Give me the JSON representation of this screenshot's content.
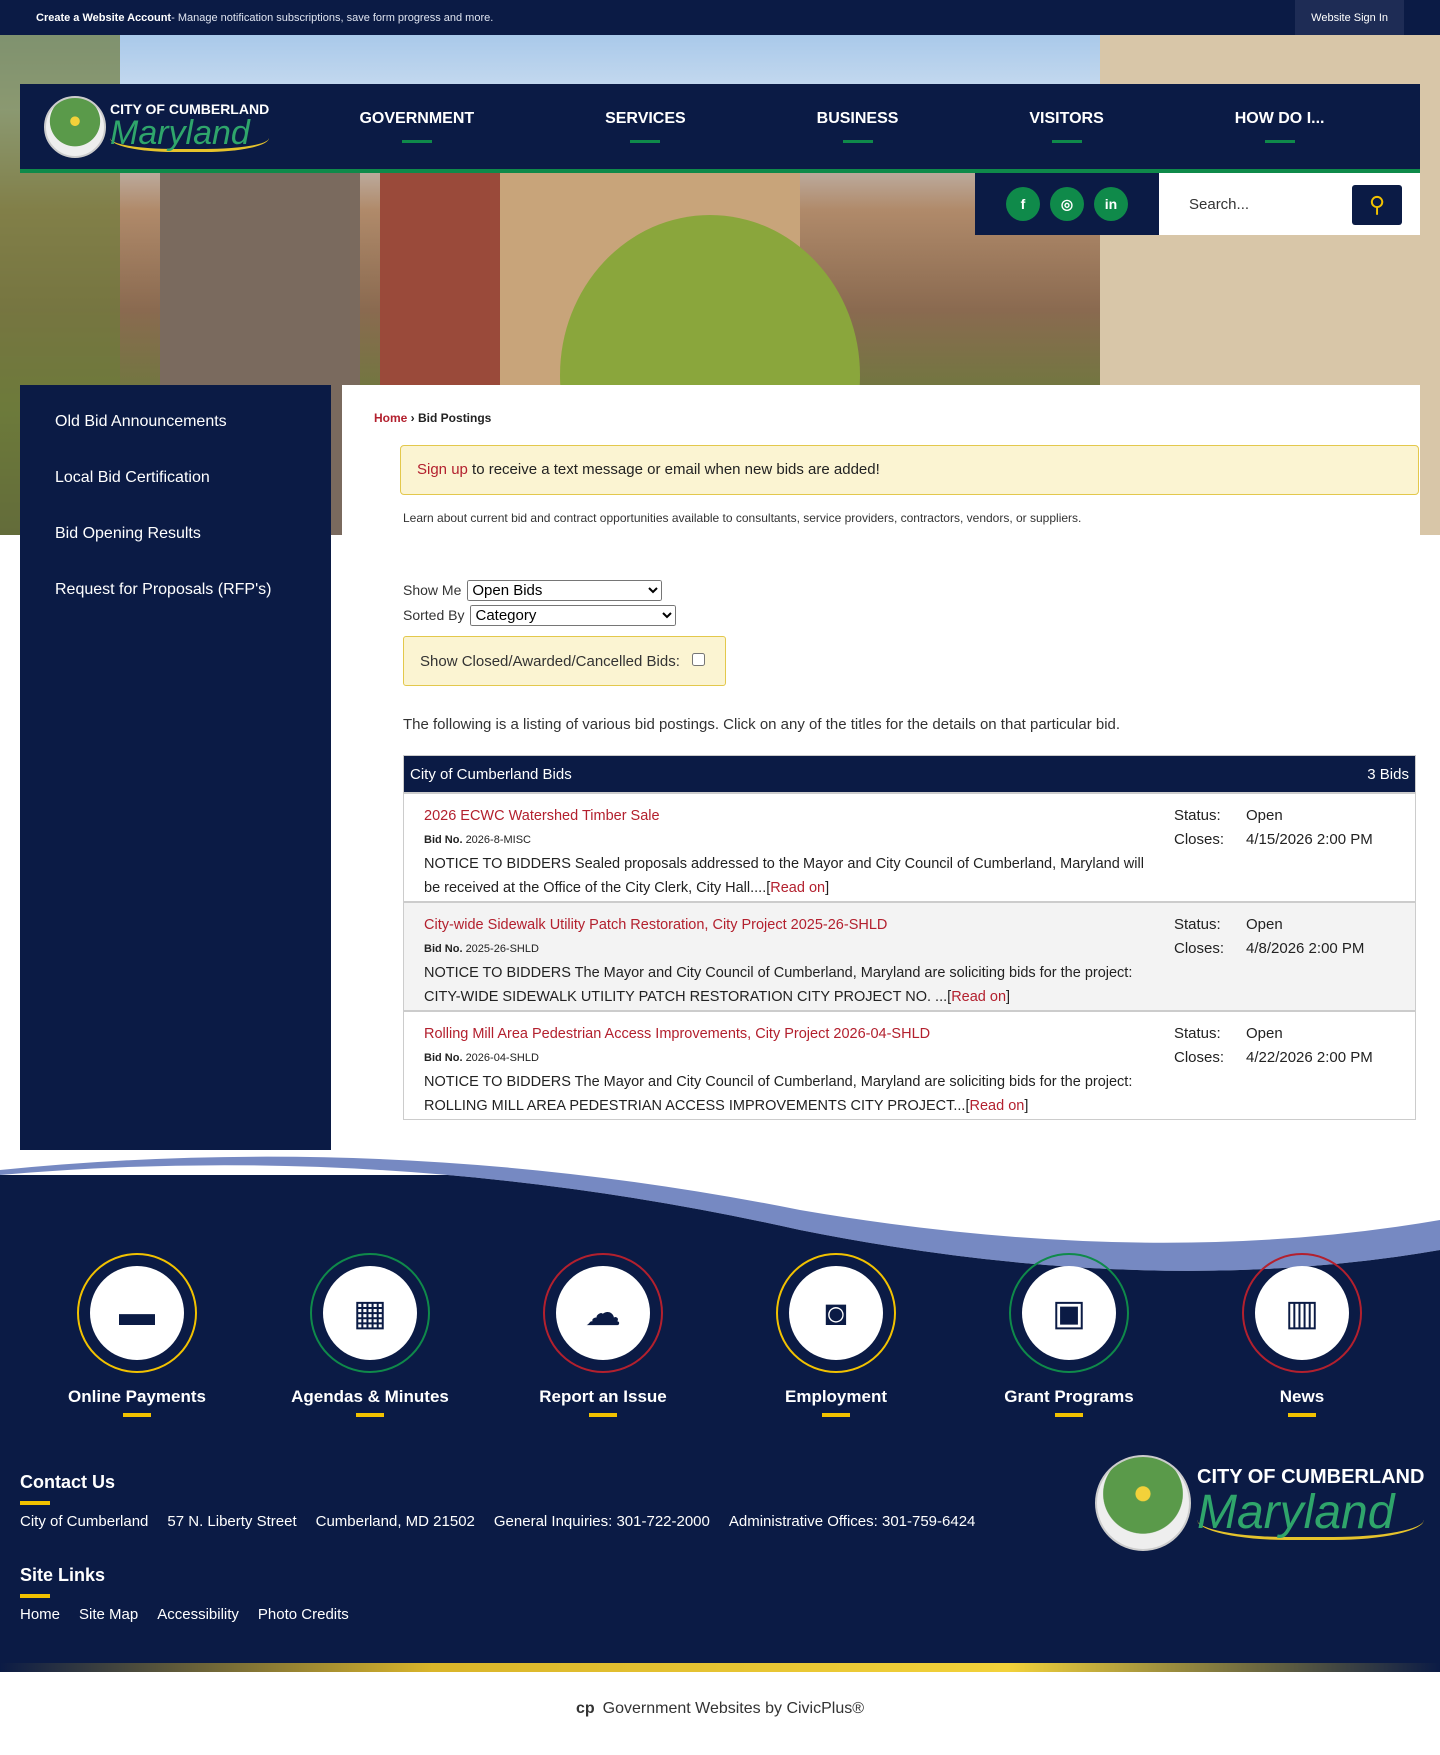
{
  "topbar": {
    "account_link": "Create a Website Account",
    "account_desc": " - Manage notification subscriptions, save form progress and more.",
    "signin": "Website Sign In"
  },
  "logo": {
    "line1": "CITY OF CUMBERLAND",
    "line2": "Maryland"
  },
  "nav": [
    "GOVERNMENT",
    "SERVICES",
    "BUSINESS",
    "VISITORS",
    "HOW DO I..."
  ],
  "social": [
    "facebook",
    "instagram",
    "linkedin"
  ],
  "search": {
    "placeholder": "Search..."
  },
  "sidebar": [
    "Old Bid Announcements",
    "Local Bid Certification",
    "Bid Opening Results",
    "Request for Proposals (RFP's)"
  ],
  "breadcrumb": {
    "home": "Home",
    "sep": " › ",
    "current": "Bid Postings"
  },
  "alert": {
    "link": "Sign up",
    "text": " to receive a text message or email when new bids are added!"
  },
  "intro": "Learn about current bid and contract opportunities available to consultants, service providers, contractors, vendors, or suppliers.",
  "filters": {
    "show_label": "Show Me",
    "show_value": "Open Bids",
    "sort_label": "Sorted By",
    "sort_value": "Category",
    "closed_label": "Show Closed/Awarded/Cancelled Bids:"
  },
  "listing_text": "The following is a listing of various bid postings. Click on any of the titles for the details on that particular bid.",
  "table": {
    "title": "City of Cumberland Bids",
    "count": "3 Bids",
    "bidno_label": "Bid No.",
    "status_label": "Status:",
    "closes_label": "Closes:",
    "read_on": "Read on",
    "rows": [
      {
        "title": "2026 ECWC Watershed Timber Sale",
        "bidno": "2026-8-MISC",
        "desc": "NOTICE TO BIDDERS Sealed proposals addressed to the Mayor and City Council of Cumberland, Maryland will be received at the Office of the City Clerk, City Hall....",
        "status": "Open",
        "closes": "4/15/2026 2:00 PM"
      },
      {
        "title": "City-wide Sidewalk Utility Patch Restoration, City Project 2025-26-SHLD",
        "bidno": "2025-26-SHLD",
        "desc": "NOTICE TO BIDDERS The Mayor and City Council of Cumberland, Maryland are soliciting bids for the project: CITY-WIDE SIDEWALK UTILITY PATCH RESTORATION CITY PROJECT NO. ...",
        "status": "Open",
        "closes": "4/8/2026 2:00 PM"
      },
      {
        "title": "Rolling Mill Area Pedestrian Access Improvements, City Project 2026-04-SHLD",
        "bidno": "2026-04-SHLD",
        "desc": "NOTICE TO BIDDERS The Mayor and City Council of Cumberland, Maryland are soliciting bids for the project: ROLLING MILL AREA PEDESTRIAN ACCESS IMPROVEMENTS CITY PROJECT...",
        "status": "Open",
        "closes": "4/22/2026 2:00 PM"
      }
    ]
  },
  "quicklinks": [
    {
      "label": "Online Payments",
      "icon": "credit-card-icon",
      "color": "#f2c200"
    },
    {
      "label": "Agendas & Minutes",
      "icon": "calendar-icon",
      "color": "#0f8a4a"
    },
    {
      "label": "Report an Issue",
      "icon": "chat-icon",
      "color": "#b3202e"
    },
    {
      "label": "Employment",
      "icon": "briefcase-icon",
      "color": "#f2c200"
    },
    {
      "label": "Grant Programs",
      "icon": "folder-plus-icon",
      "color": "#0f8a4a"
    },
    {
      "label": "News",
      "icon": "book-icon",
      "color": "#b3202e"
    }
  ],
  "contact": {
    "heading": "Contact Us",
    "items": [
      "City of Cumberland",
      "57 N. Liberty Street",
      "Cumberland, MD 21502",
      "General Inquiries: 301-722-2000",
      "Administrative Offices: 301-759-6424"
    ]
  },
  "sitelinks": {
    "heading": "Site Links",
    "items": [
      "Home",
      "Site Map",
      "Accessibility",
      "Photo Credits"
    ]
  },
  "credit": {
    "text": "Government Websites by ",
    "link": "CivicPlus®"
  }
}
